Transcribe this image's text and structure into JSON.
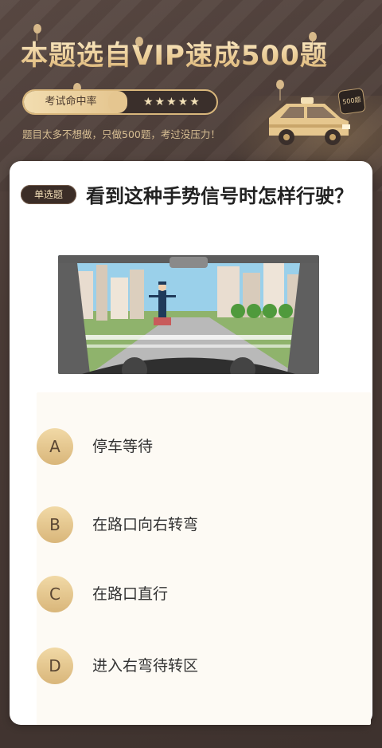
{
  "header": {
    "headline": "本题选自VIP速成500题",
    "rate_label": "考试命中率",
    "rating": "★★★★★",
    "subtitle": "题目太多不想做，只做500题，考过没压力！",
    "badge": "500题"
  },
  "question": {
    "type_tag": "单选题",
    "text": "看到这种手势信号时怎样行驶？",
    "options": [
      {
        "letter": "A",
        "text": "停车等待"
      },
      {
        "letter": "B",
        "text": "在路口向右转弯"
      },
      {
        "letter": "C",
        "text": "在路口直行"
      },
      {
        "letter": "D",
        "text": "进入右弯待转区"
      }
    ]
  },
  "colors": {
    "background": "#4a3b36",
    "gold": "#e5c690",
    "card": "#ffffff",
    "options_panel": "#fdfaf4"
  }
}
